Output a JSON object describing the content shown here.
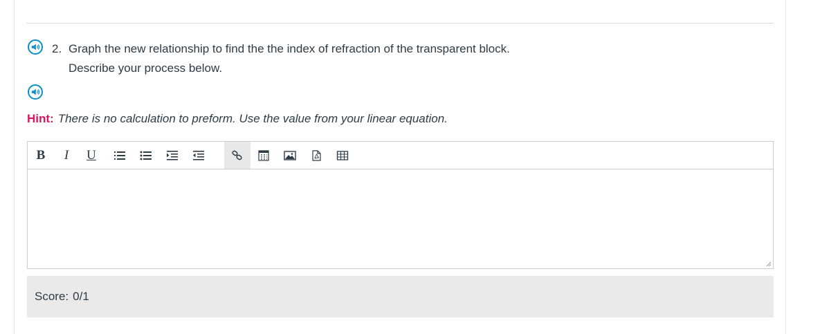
{
  "question": {
    "number": "2.",
    "line1": "Graph the new relationship to find the the index of refraction of the transparent block.",
    "line2": "Describe your process below."
  },
  "hint": {
    "label": "Hint:",
    "text": "There is no calculation to preform. Use the value from your linear equation."
  },
  "toolbar": {
    "bold": "B",
    "italic": "I",
    "underline": "U",
    "icons": [
      "ordered-list-icon",
      "unordered-list-icon",
      "indent-icon",
      "outdent-icon",
      "link-icon",
      "equation-icon",
      "image-icon",
      "pdf-icon",
      "table-icon"
    ]
  },
  "editor": {
    "value": ""
  },
  "score": {
    "label": "Score:",
    "value": "0/1"
  },
  "colors": {
    "accent": "#0a8fc7",
    "hint": "#e0115f",
    "score_bg": "#eaeaea"
  }
}
